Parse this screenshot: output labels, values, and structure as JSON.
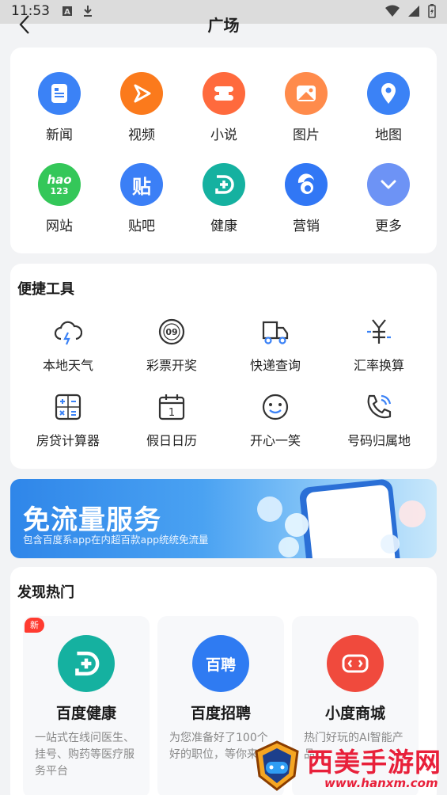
{
  "status_bar": {
    "time": "11:53"
  },
  "header": {
    "title": "广场"
  },
  "apps": [
    {
      "label": "新闻",
      "icon": "news-icon",
      "color": "#3b82f6"
    },
    {
      "label": "视频",
      "icon": "video-play-icon",
      "color": "#fb7a1c"
    },
    {
      "label": "小说",
      "icon": "novel-book-icon",
      "color": "#ff6a3d"
    },
    {
      "label": "图片",
      "icon": "picture-icon",
      "color": "#ff8b4b"
    },
    {
      "label": "地图",
      "icon": "map-pin-icon",
      "color": "#3b82f6"
    },
    {
      "label": "网站",
      "icon": "hao123-icon",
      "color": "#34c759",
      "icon_text_top": "hao",
      "icon_text_bottom": "123"
    },
    {
      "label": "贴吧",
      "icon": "tieba-icon",
      "color": "#3b7ff6",
      "icon_text_top": "贴"
    },
    {
      "label": "健康",
      "icon": "health-cross-icon",
      "color": "#15b1a0"
    },
    {
      "label": "营销",
      "icon": "marketing-swirl-icon",
      "color": "#3177f5"
    },
    {
      "label": "更多",
      "icon": "chevron-down-icon",
      "color": "#6d93f5"
    }
  ],
  "tools": {
    "title": "便捷工具",
    "items": [
      {
        "label": "本地天气",
        "icon": "weather-icon"
      },
      {
        "label": "彩票开奖",
        "icon": "lottery-icon",
        "icon_text_top": "09"
      },
      {
        "label": "快递查询",
        "icon": "delivery-truck-icon"
      },
      {
        "label": "汇率换算",
        "icon": "currency-exchange-icon"
      },
      {
        "label": "房贷计算器",
        "icon": "calculator-icon"
      },
      {
        "label": "假日日历",
        "icon": "calendar-icon",
        "icon_text_top": "1"
      },
      {
        "label": "开心一笑",
        "icon": "smile-icon"
      },
      {
        "label": "号码归属地",
        "icon": "phone-location-icon"
      }
    ]
  },
  "banner": {
    "headline": "免流量服务",
    "subline": "包含百度系app在内超百款app统统免流量"
  },
  "hot": {
    "title": "发现热门",
    "badge": "新",
    "items": [
      {
        "name": "百度健康",
        "desc": "一站式在线问医生、挂号、购药等医疗服务平台",
        "color": "#15b1a0",
        "icon": "baidu-health-icon"
      },
      {
        "name": "百度招聘",
        "desc": "为您准备好了100个好的职位，等你来",
        "color": "#2f7bf2",
        "icon": "baidu-recruit-icon",
        "icon_text_top": "百聘"
      },
      {
        "name": "小度商城",
        "desc": "热门好玩的AI智能产品",
        "color": "#f04a3d",
        "icon": "xiaodu-store-icon"
      }
    ]
  },
  "watermark": {
    "name": "西美手游网",
    "url": "www.hanxm.com"
  }
}
